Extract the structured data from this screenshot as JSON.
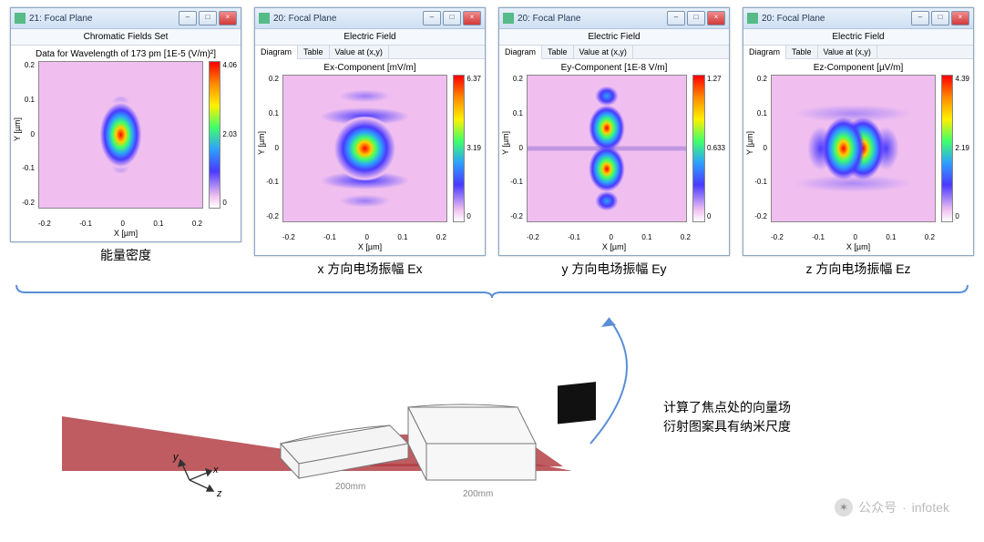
{
  "windows": [
    {
      "title": "21: Focal Plane",
      "subtitle": "Chromatic Fields Set",
      "plot_title": "Data for Wavelength of 173 pm  [1E-5 (V/m)²]",
      "tabs": null,
      "cmax": "4.06",
      "cmid": "2.03",
      "cmin": "0",
      "caption": "能量密度",
      "cls": "en"
    },
    {
      "title": "20: Focal Plane",
      "subtitle": "Electric Field",
      "plot_title": "Ex-Component  [mV/m]",
      "tabs": [
        "Diagram",
        "Table",
        "Value at (x,y)"
      ],
      "cmax": "6.37",
      "cmid": "3.19",
      "cmin": "0",
      "caption": "x 方向电场振幅 Ex",
      "cls": "ex"
    },
    {
      "title": "20: Focal Plane",
      "subtitle": "Electric Field",
      "plot_title": "Ey-Component  [1E-8 V/m]",
      "tabs": [
        "Diagram",
        "Table",
        "Value at (x,y)"
      ],
      "cmax": "1.27",
      "cmid": "0.633",
      "cmin": "0",
      "caption": "y 方向电场振幅 Ey",
      "cls": "ey"
    },
    {
      "title": "20: Focal Plane",
      "subtitle": "Electric Field",
      "plot_title": "Ez-Component  [µV/m]",
      "tabs": [
        "Diagram",
        "Table",
        "Value at (x,y)"
      ],
      "cmax": "4.39",
      "cmid": "2.19",
      "cmin": "0",
      "caption": "z 方向电场振幅 Ez",
      "cls": "ez"
    }
  ],
  "axis": {
    "yticks": [
      "0.2",
      "0.1",
      "0",
      "-0.1",
      "-0.2"
    ],
    "xticks": [
      "-0.2",
      "-0.1",
      "0",
      "0.1",
      "0.2"
    ],
    "xlabel": "X [µm]",
    "ylabel": "Y [µm]"
  },
  "diagram": {
    "mirror1_dim": "200mm",
    "mirror2_dim": "200mm",
    "question": "?",
    "axes": {
      "x": "x",
      "y": "y",
      "z": "z"
    }
  },
  "annotation": {
    "line1": "计算了焦点处的向量场",
    "line2": "衍射图案具有纳米尺度"
  },
  "watermark": {
    "prefix": "公众号",
    "sep": "·",
    "name": "infotek"
  },
  "winbtns": {
    "min": "–",
    "max": "□",
    "close": "×"
  },
  "chart_data": {
    "type": "heatmap",
    "description": "Four focal-plane intensity/field maps from optical simulation",
    "x_range_um": [
      -0.25,
      0.25
    ],
    "y_range_um": [
      -0.25,
      0.25
    ],
    "xlabel": "X [µm]",
    "ylabel": "Y [µm]",
    "panels": [
      {
        "name": "Energy density",
        "units": "1E-5 (V/m)²",
        "wavelength_pm": 173,
        "value_range": [
          0,
          4.06
        ],
        "pattern": "single central Airy-like spot"
      },
      {
        "name": "Ex",
        "units": "mV/m",
        "value_range": [
          0,
          6.37
        ],
        "pattern": "central lobe with vertical sidelobes"
      },
      {
        "name": "Ey",
        "units": "1E-8 V/m",
        "value_range": [
          0,
          1.27
        ],
        "pattern": "two vertical lobes with central null"
      },
      {
        "name": "Ez",
        "units": "µV/m",
        "value_range": [
          0,
          4.39
        ],
        "pattern": "two horizontal lobes with central null"
      }
    ]
  }
}
